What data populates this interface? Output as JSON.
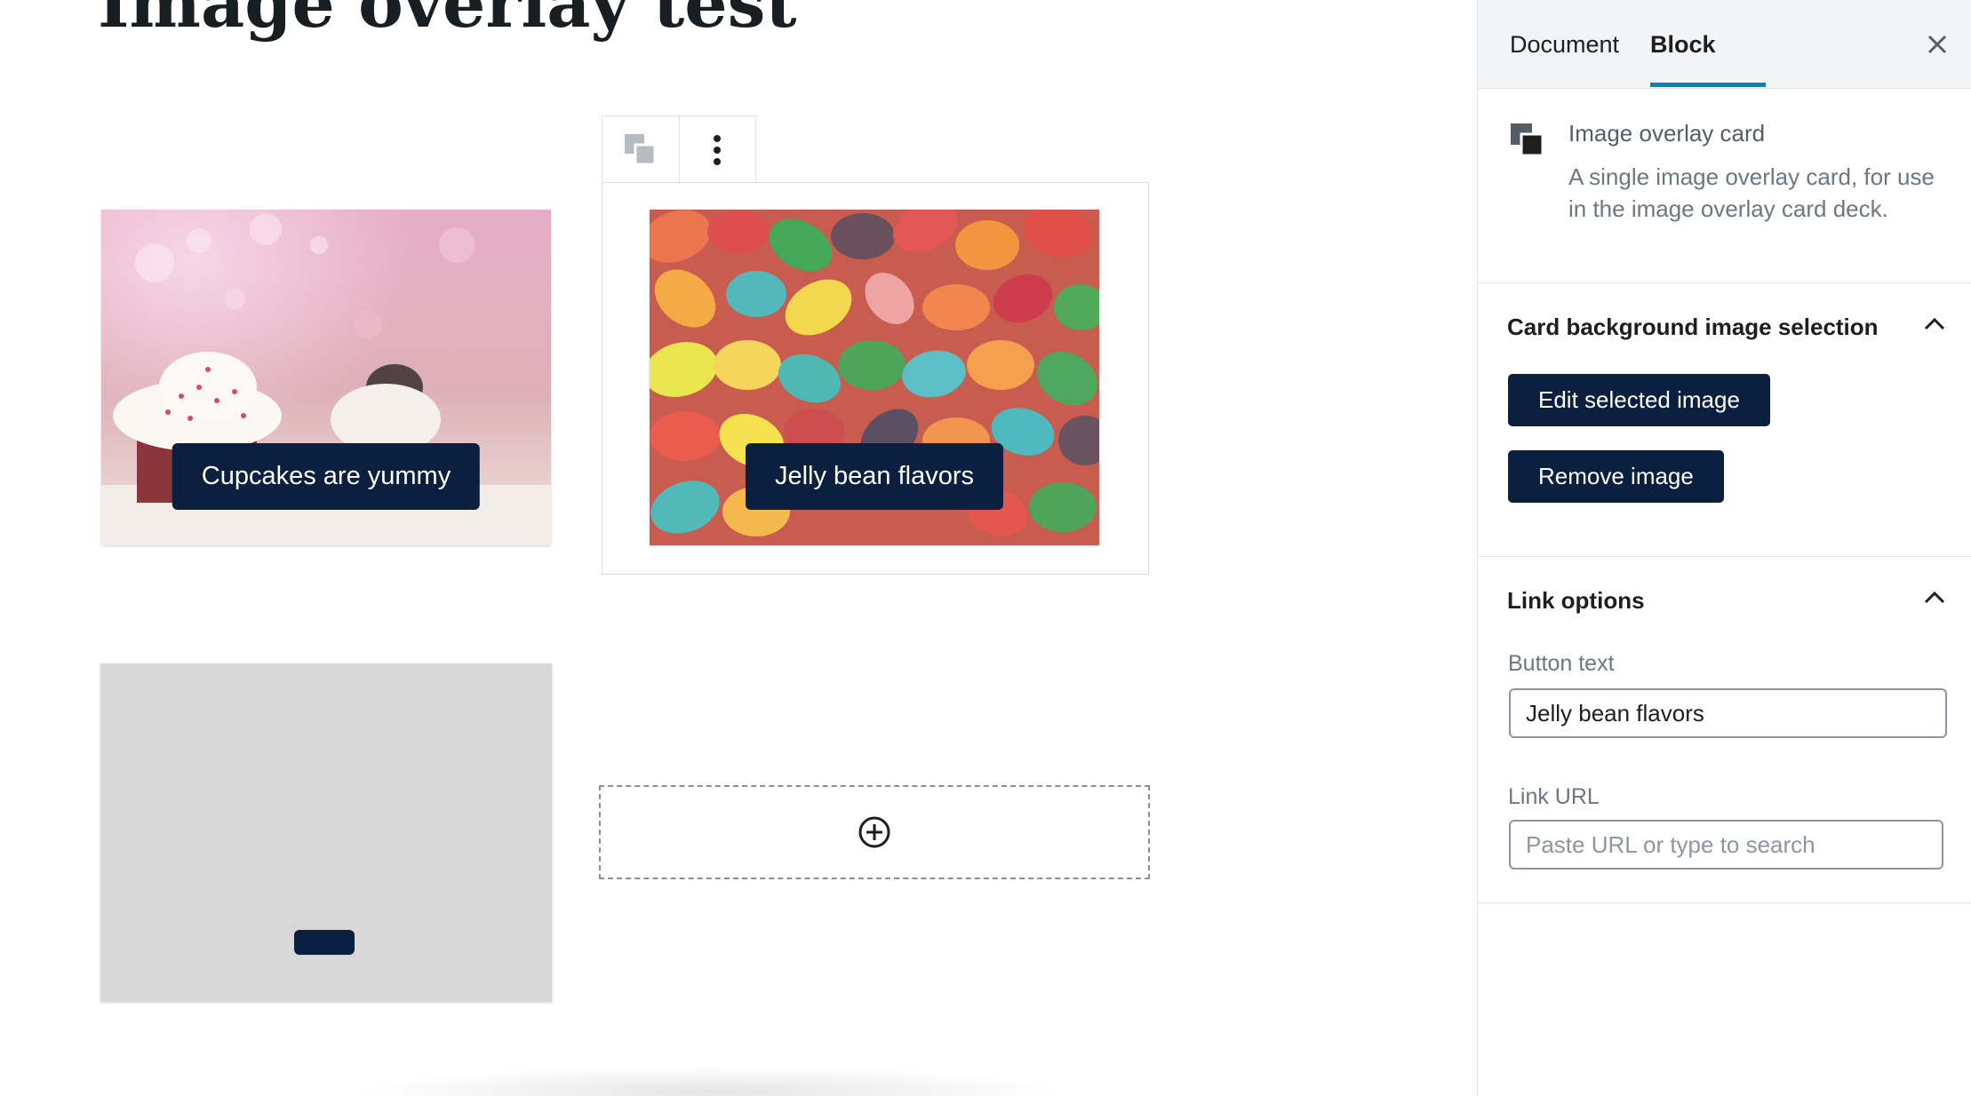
{
  "editor": {
    "post_title": "Image overlay test",
    "cards": [
      {
        "button_text": "Cupcakes are yummy",
        "image": "cupcakes-photo"
      },
      {
        "button_text": "Jelly bean flavors",
        "image": "jelly-beans-photo"
      },
      {
        "button_text": "",
        "image": "none"
      }
    ],
    "appender_icon": "plus-circle-icon"
  },
  "sidebar": {
    "tabs": [
      {
        "label": "Document",
        "active": false
      },
      {
        "label": "Block",
        "active": true
      }
    ],
    "block_card": {
      "title": "Image overlay card",
      "description": "A single image overlay card, for use in the image overlay card deck."
    },
    "background_panel": {
      "title": "Card background image selection",
      "expanded": true,
      "edit_button": "Edit selected image",
      "remove_button": "Remove image"
    },
    "link_panel": {
      "title": "Link options",
      "expanded": true,
      "button_text_label": "Button text",
      "button_text_value": "Jelly bean flavors",
      "link_url_label": "Link URL",
      "link_url_placeholder": "Paste URL or type to search"
    }
  },
  "colors": {
    "accent": "#0085ba",
    "button_dark": "#0b1f3f",
    "placeholder_card": "#d8d8d8"
  }
}
